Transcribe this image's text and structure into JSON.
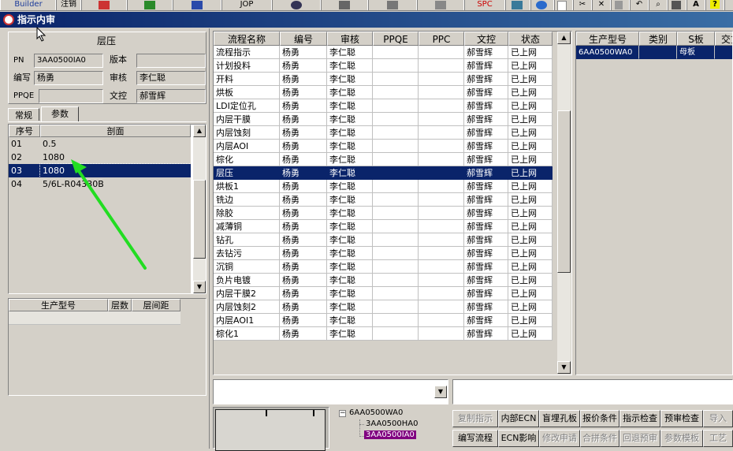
{
  "toolbar": {
    "items": [
      "Builder",
      "注销",
      "JOP",
      "SPC"
    ]
  },
  "window": {
    "title": "指示内审"
  },
  "left_panel": {
    "process_name": "层压",
    "pn_label": "PN",
    "pn_value": "3AA0500IA0",
    "version_label": "版本",
    "version_value": "",
    "author_label": "编写",
    "author_value": "杨勇",
    "reviewer_label": "审核",
    "reviewer_value": "李仁聪",
    "ppqe_label": "PPQE",
    "ppqe_value": "",
    "control_label": "文控",
    "control_value": "郝雪辉",
    "tabs": [
      "常规",
      "参数"
    ],
    "param_table": {
      "headers": [
        "序号",
        "剖面"
      ],
      "rows": [
        {
          "seq": "01",
          "profile": "0.5"
        },
        {
          "seq": "02",
          "profile": "1080"
        },
        {
          "seq": "03",
          "profile": "1080"
        },
        {
          "seq": "04",
          "profile": "5/6L-R04330B"
        }
      ]
    },
    "layer_table": {
      "headers": [
        "生产型号",
        "层数",
        "层间距"
      ]
    }
  },
  "flow_table": {
    "headers": [
      "流程名称",
      "编号",
      "审核",
      "PPQE",
      "PPC",
      "文控",
      "状态"
    ],
    "rows": [
      {
        "name": "流程指示",
        "code": "杨勇",
        "review": "李仁聪",
        "ppqe": "",
        "ppc": "",
        "ctrl": "郝雪辉",
        "status": "已上网"
      },
      {
        "name": "计划投料",
        "code": "杨勇",
        "review": "李仁聪",
        "ppqe": "",
        "ppc": "",
        "ctrl": "郝雪辉",
        "status": "已上网"
      },
      {
        "name": "开料",
        "code": "杨勇",
        "review": "李仁聪",
        "ppqe": "",
        "ppc": "",
        "ctrl": "郝雪辉",
        "status": "已上网"
      },
      {
        "name": "烘板",
        "code": "杨勇",
        "review": "李仁聪",
        "ppqe": "",
        "ppc": "",
        "ctrl": "郝雪辉",
        "status": "已上网"
      },
      {
        "name": "LDI定位孔",
        "code": "杨勇",
        "review": "李仁聪",
        "ppqe": "",
        "ppc": "",
        "ctrl": "郝雪辉",
        "status": "已上网"
      },
      {
        "name": "内层干膜",
        "code": "杨勇",
        "review": "李仁聪",
        "ppqe": "",
        "ppc": "",
        "ctrl": "郝雪辉",
        "status": "已上网"
      },
      {
        "name": "内层蚀刻",
        "code": "杨勇",
        "review": "李仁聪",
        "ppqe": "",
        "ppc": "",
        "ctrl": "郝雪辉",
        "status": "已上网"
      },
      {
        "name": "内层AOI",
        "code": "杨勇",
        "review": "李仁聪",
        "ppqe": "",
        "ppc": "",
        "ctrl": "郝雪辉",
        "status": "已上网"
      },
      {
        "name": "棕化",
        "code": "杨勇",
        "review": "李仁聪",
        "ppqe": "",
        "ppc": "",
        "ctrl": "郝雪辉",
        "status": "已上网"
      },
      {
        "name": "层压",
        "code": "杨勇",
        "review": "李仁聪",
        "ppqe": "",
        "ppc": "",
        "ctrl": "郝雪辉",
        "status": "已上网"
      },
      {
        "name": "烘板1",
        "code": "杨勇",
        "review": "李仁聪",
        "ppqe": "",
        "ppc": "",
        "ctrl": "郝雪辉",
        "status": "已上网"
      },
      {
        "name": "铣边",
        "code": "杨勇",
        "review": "李仁聪",
        "ppqe": "",
        "ppc": "",
        "ctrl": "郝雪辉",
        "status": "已上网"
      },
      {
        "name": "除胶",
        "code": "杨勇",
        "review": "李仁聪",
        "ppqe": "",
        "ppc": "",
        "ctrl": "郝雪辉",
        "status": "已上网"
      },
      {
        "name": "减薄铜",
        "code": "杨勇",
        "review": "李仁聪",
        "ppqe": "",
        "ppc": "",
        "ctrl": "郝雪辉",
        "status": "已上网"
      },
      {
        "name": "钻孔",
        "code": "杨勇",
        "review": "李仁聪",
        "ppqe": "",
        "ppc": "",
        "ctrl": "郝雪辉",
        "status": "已上网"
      },
      {
        "name": "去钻污",
        "code": "杨勇",
        "review": "李仁聪",
        "ppqe": "",
        "ppc": "",
        "ctrl": "郝雪辉",
        "status": "已上网"
      },
      {
        "name": "沉铜",
        "code": "杨勇",
        "review": "李仁聪",
        "ppqe": "",
        "ppc": "",
        "ctrl": "郝雪辉",
        "status": "已上网"
      },
      {
        "name": "负片电镀",
        "code": "杨勇",
        "review": "李仁聪",
        "ppqe": "",
        "ppc": "",
        "ctrl": "郝雪辉",
        "status": "已上网"
      },
      {
        "name": "内层干膜2",
        "code": "杨勇",
        "review": "李仁聪",
        "ppqe": "",
        "ppc": "",
        "ctrl": "郝雪辉",
        "status": "已上网"
      },
      {
        "name": "内层蚀刻2",
        "code": "杨勇",
        "review": "李仁聪",
        "ppqe": "",
        "ppc": "",
        "ctrl": "郝雪辉",
        "status": "已上网"
      },
      {
        "name": "内层AOI1",
        "code": "杨勇",
        "review": "李仁聪",
        "ppqe": "",
        "ppc": "",
        "ctrl": "郝雪辉",
        "status": "已上网"
      },
      {
        "name": "棕化1",
        "code": "杨勇",
        "review": "李仁聪",
        "ppqe": "",
        "ppc": "",
        "ctrl": "郝雪辉",
        "status": "已上网"
      }
    ],
    "selected_index": 9
  },
  "model_table": {
    "headers": [
      "生产型号",
      "类别",
      "S板",
      "交货"
    ],
    "rows": [
      {
        "model": "6AA0500WA0",
        "category": "",
        "sboard": "母板",
        "delivery": ""
      }
    ]
  },
  "tree": {
    "root": "6AA0500WA0",
    "children": [
      "3AA0500HA0",
      "3AA0500IA0"
    ],
    "expand_glyph": "−"
  },
  "buttons": {
    "row1": [
      "复制指示",
      "内部ECN",
      "盲埋孔板",
      "报价条件",
      "指示检查",
      "预审检查",
      "导入"
    ],
    "row2": [
      "编写流程",
      "ECN影响",
      "修改申请",
      "合拼条件",
      "回退预审",
      "参数模板",
      "工艺"
    ],
    "row1_disabled": [
      true,
      false,
      false,
      false,
      false,
      false,
      true
    ],
    "row2_disabled": [
      false,
      false,
      true,
      true,
      true,
      true,
      true
    ]
  },
  "annotation_color": "#22dd22",
  "selection_color": "#0a246a",
  "tree_highlight_color": "#800080"
}
